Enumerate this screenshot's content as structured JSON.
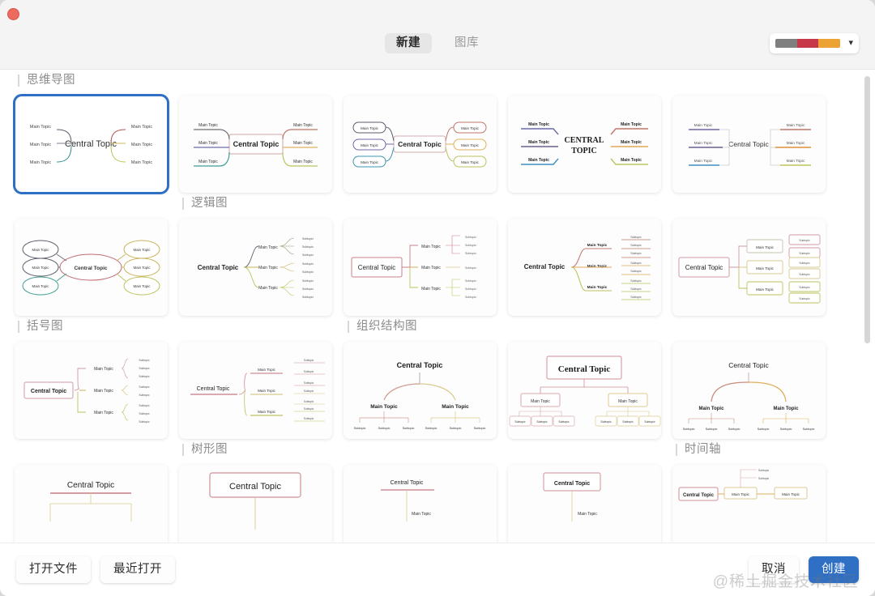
{
  "window": {
    "close_button": "close",
    "palette_colors": [
      "#7f7f7f",
      "#c8384b",
      "#eda234"
    ],
    "chevron": "⌄"
  },
  "header": {
    "tabs": [
      {
        "label": "新建",
        "active": true
      },
      {
        "label": "图库",
        "active": false
      }
    ]
  },
  "labels": {
    "central_topic": "Central Topic",
    "central_topic_caps": "CENTRAL TOPIC",
    "main_topic": "Main Topic",
    "subtopic": "Subtopic"
  },
  "sections": [
    {
      "name": "思维导图",
      "row": 0,
      "col": 0
    },
    {
      "name": "逻辑图",
      "row": 1,
      "col": 1
    },
    {
      "name": "括号图",
      "row": 2,
      "col": 0
    },
    {
      "name": "组织结构图",
      "row": 2,
      "col": 2
    },
    {
      "name": "树形图",
      "row": 3,
      "col": 1
    },
    {
      "name": "时间轴",
      "row": 3,
      "col": 4
    }
  ],
  "rows": [
    {
      "cards": [
        {
          "template": "mindmap-curved",
          "selected": true
        },
        {
          "template": "mindmap-box",
          "selected": false
        },
        {
          "template": "mindmap-pills",
          "selected": false
        },
        {
          "template": "mindmap-underline-serif",
          "selected": false
        },
        {
          "template": "mindmap-underline",
          "selected": false
        }
      ]
    },
    {
      "cards": [
        {
          "template": "logic-ellipse",
          "selected": false
        },
        {
          "template": "logic-curve",
          "selected": false
        },
        {
          "template": "logic-box-right",
          "selected": false
        },
        {
          "template": "logic-underline",
          "selected": false
        },
        {
          "template": "logic-boxed",
          "selected": false
        }
      ]
    },
    {
      "cards": [
        {
          "template": "bracket-plain",
          "selected": false
        },
        {
          "template": "bracket-underline",
          "selected": false
        },
        {
          "template": "org-plain",
          "selected": false
        },
        {
          "template": "org-boxed",
          "selected": false
        },
        {
          "template": "org-curved",
          "selected": false
        }
      ]
    },
    {
      "cards": [
        {
          "template": "tree-underline",
          "selected": false
        },
        {
          "template": "tree-boxed",
          "selected": false
        },
        {
          "template": "tree-small-underline",
          "selected": false
        },
        {
          "template": "tree-small-boxed",
          "selected": false
        },
        {
          "template": "timeline",
          "selected": false
        }
      ]
    }
  ],
  "footer": {
    "open_file": "打开文件",
    "recent": "最近打开",
    "cancel": "取消",
    "create": "创建",
    "watermark": "@稀土掘金技术社区"
  }
}
